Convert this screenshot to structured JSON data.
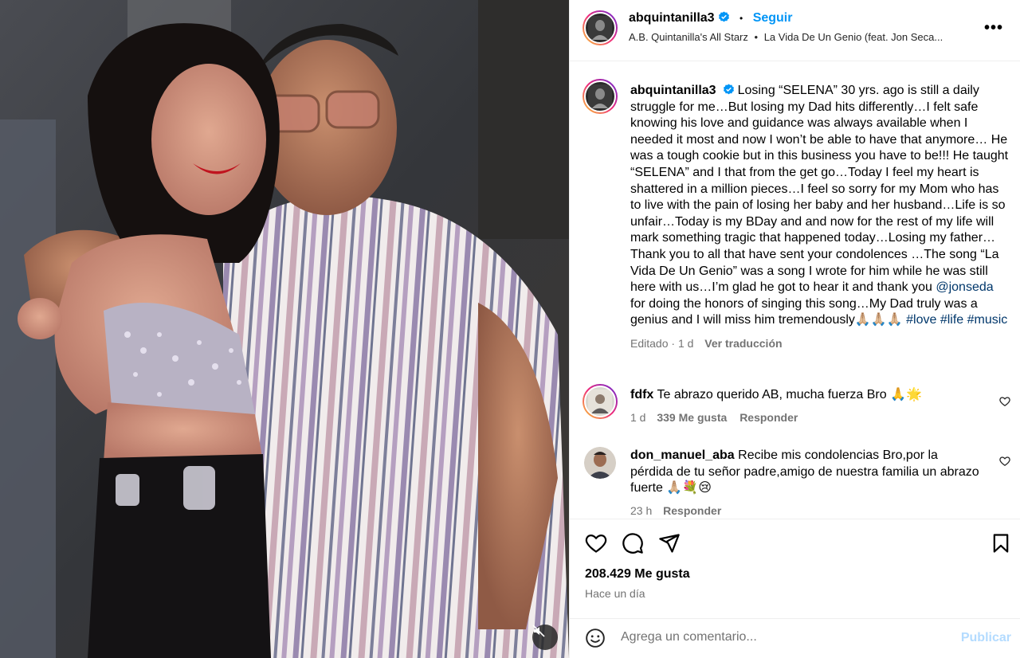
{
  "header": {
    "username": "abquintanilla3",
    "separator": "•",
    "follow_label": "Seguir",
    "audio_artist": "A.B. Quintanilla's All Starz",
    "audio_dot": "•",
    "audio_title": "La Vida De Un Genio (feat. Jon Seca...",
    "more_icon": "more-horizontal-icon"
  },
  "caption": {
    "username": "abquintanilla3",
    "text_a": "Losing “SELENA” 30 yrs. ago is still a daily struggle for me…But losing my Dad hits differently…I felt safe knowing his love and guidance was always available when I needed it most and now I won’t be able to have that anymore… He was a tough cookie but in this business you have to be!!! He taught “SELENA” and I that from the get go…Today I feel my heart is shattered in a million pieces…I feel so sorry for my Mom who has to live with the pain of losing her baby and her husband…Life is so unfair…Today is my BDay and and now for the rest of my life will mark something tragic that happened today…Losing my father…Thank you to all that have sent your condolences …The song “La Vida De Un Genio” was a song I wrote for him while he was still here with us…I’m glad he got to hear it and thank you",
    "mention": "@jonseda",
    "text_b": "for doing the honors of singing this song…My Dad truly was a genius and I will miss him tremendously🙏🏼🙏🏼🙏🏼",
    "tags": [
      "#love",
      "#life",
      "#music"
    ],
    "edited": "Editado",
    "dot": "·",
    "age": "1 d",
    "translate": "Ver traducción"
  },
  "comments": [
    {
      "username": "fdfx",
      "text": "Te abrazo querido AB, mucha fuerza Bro 🙏🌟",
      "age": "1 d",
      "likes": "339 Me gusta",
      "reply": "Responder"
    },
    {
      "username": "don_manuel_aba",
      "text": "Recibe mis condolencias Bro,por la pérdida de tu señor padre,amigo de nuestra familia un abrazo fuerte 🙏🏼💐😢",
      "age": "23 h",
      "reply": "Responder"
    }
  ],
  "footer": {
    "likes": "208.429 Me gusta",
    "time": "Hace un día",
    "comment_placeholder": "Agrega un comentario...",
    "post_label": "Publicar"
  },
  "colors": {
    "link_blue": "#0095f6",
    "tag_blue": "#00376b",
    "meta_gray": "#737373"
  }
}
